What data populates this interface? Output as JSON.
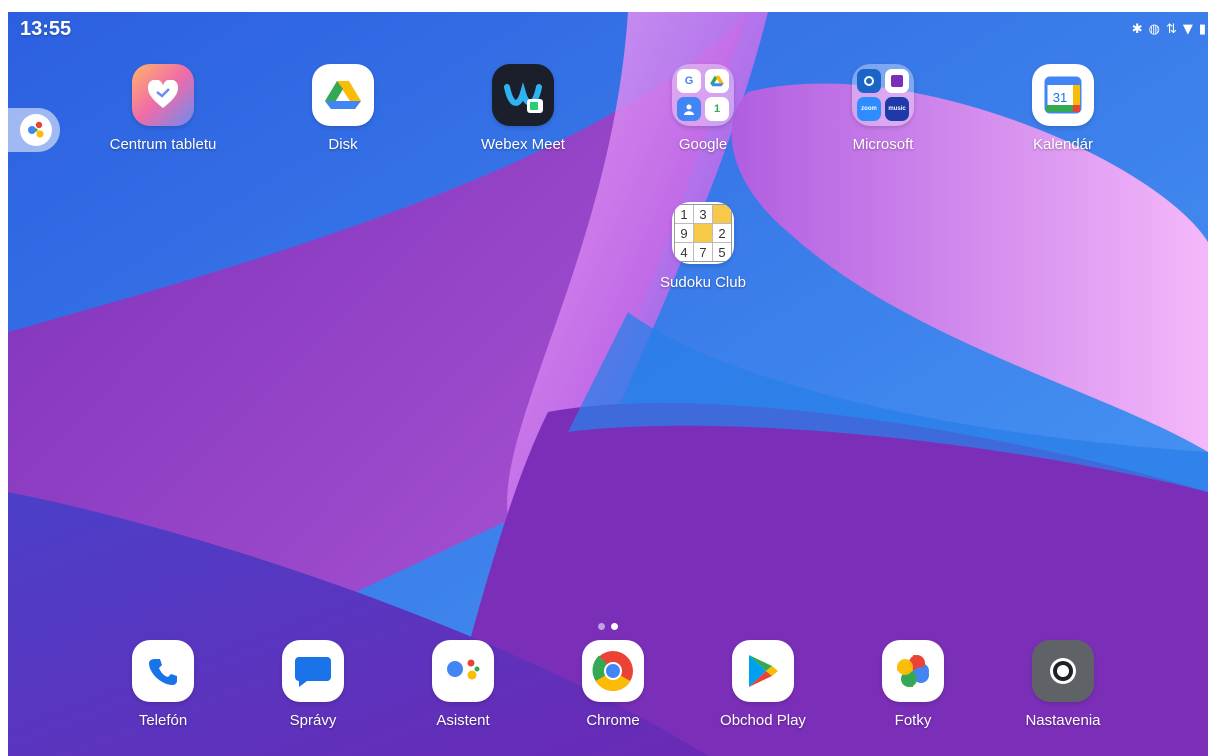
{
  "status_bar": {
    "time": "13:55",
    "icons": [
      "bluetooth-icon",
      "vibrate-icon",
      "data-icon",
      "wifi-icon",
      "battery-icon"
    ]
  },
  "home": {
    "apps": [
      {
        "label": "Centrum tabletu",
        "icon": "tablet-center-icon"
      },
      {
        "label": "Disk",
        "icon": "google-drive-icon"
      },
      {
        "label": "Webex Meet",
        "icon": "webex-icon"
      },
      {
        "label": "Google",
        "icon": "folder-icon",
        "folder": true
      },
      {
        "label": "Microsoft",
        "icon": "folder-icon",
        "folder": true
      },
      {
        "label": "Kalendár",
        "icon": "calendar-icon",
        "day": "31"
      },
      {
        "label": "Sudoku Club",
        "icon": "sudoku-icon",
        "digits": [
          "1",
          "3",
          "",
          "9",
          "",
          "2",
          "4",
          "7",
          "5"
        ]
      }
    ],
    "microsoft_folder_minis": [
      "zoom",
      "music"
    ]
  },
  "dock": {
    "apps": [
      {
        "label": "Telefón",
        "icon": "phone-icon"
      },
      {
        "label": "Správy",
        "icon": "messages-icon"
      },
      {
        "label": "Asistent",
        "icon": "assistant-icon"
      },
      {
        "label": "Chrome",
        "icon": "chrome-icon"
      },
      {
        "label": "Obchod Play",
        "icon": "play-store-icon"
      },
      {
        "label": "Fotky",
        "icon": "photos-icon"
      },
      {
        "label": "Nastavenia",
        "icon": "settings-icon"
      }
    ]
  },
  "colors": {
    "wallpaper_blue": "#3a76f0",
    "wallpaper_purple": "#8a3ed0",
    "wallpaper_pink": "#d57ef0"
  },
  "pager": {
    "pages": 2,
    "current": 2
  }
}
